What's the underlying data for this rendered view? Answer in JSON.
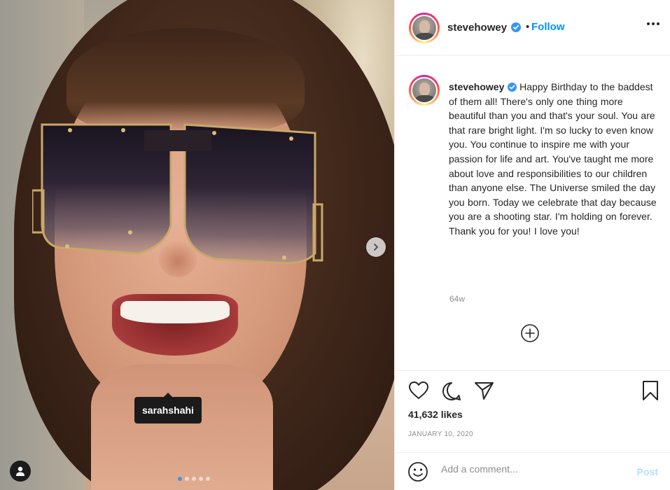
{
  "photo": {
    "user_tag": "sarahshahi",
    "carousel_total": 5,
    "carousel_active": 1
  },
  "header": {
    "username": "stevehowey",
    "separator": "•",
    "follow_label": "Follow"
  },
  "caption": {
    "username": "stevehowey",
    "text": "Happy Birthday to the baddest of them all! There's only one thing more beautiful than you and that's your soul. You are that rare bright light. I'm so lucky to even know you. You continue to inspire me with your passion for life and art. You've taught me more about love and responsibilities to our children than anyone else. The Universe smiled the day you born. Today we celebrate that day because you are a shooting star. I'm holding on forever. Thank you for you! I love you!",
    "age": "64w"
  },
  "engagement": {
    "likes": "41,632 likes",
    "date": "JANUARY 10, 2020"
  },
  "comment": {
    "placeholder": "Add a comment...",
    "post_label": "Post"
  },
  "icons": {
    "like": "heart-icon",
    "comment": "comment-icon",
    "share": "share-icon",
    "save": "bookmark-icon",
    "emoji": "emoji-icon",
    "load_more": "plus-circle-icon",
    "next": "chevron-right-icon",
    "user_tags": "user-icon",
    "verified": "verified-badge-icon",
    "more": "more-options-icon"
  },
  "colors": {
    "accent": "#0095f6",
    "verified": "#3897f0",
    "post_disabled": "#b2dffc",
    "muted": "#8e8e8e"
  }
}
